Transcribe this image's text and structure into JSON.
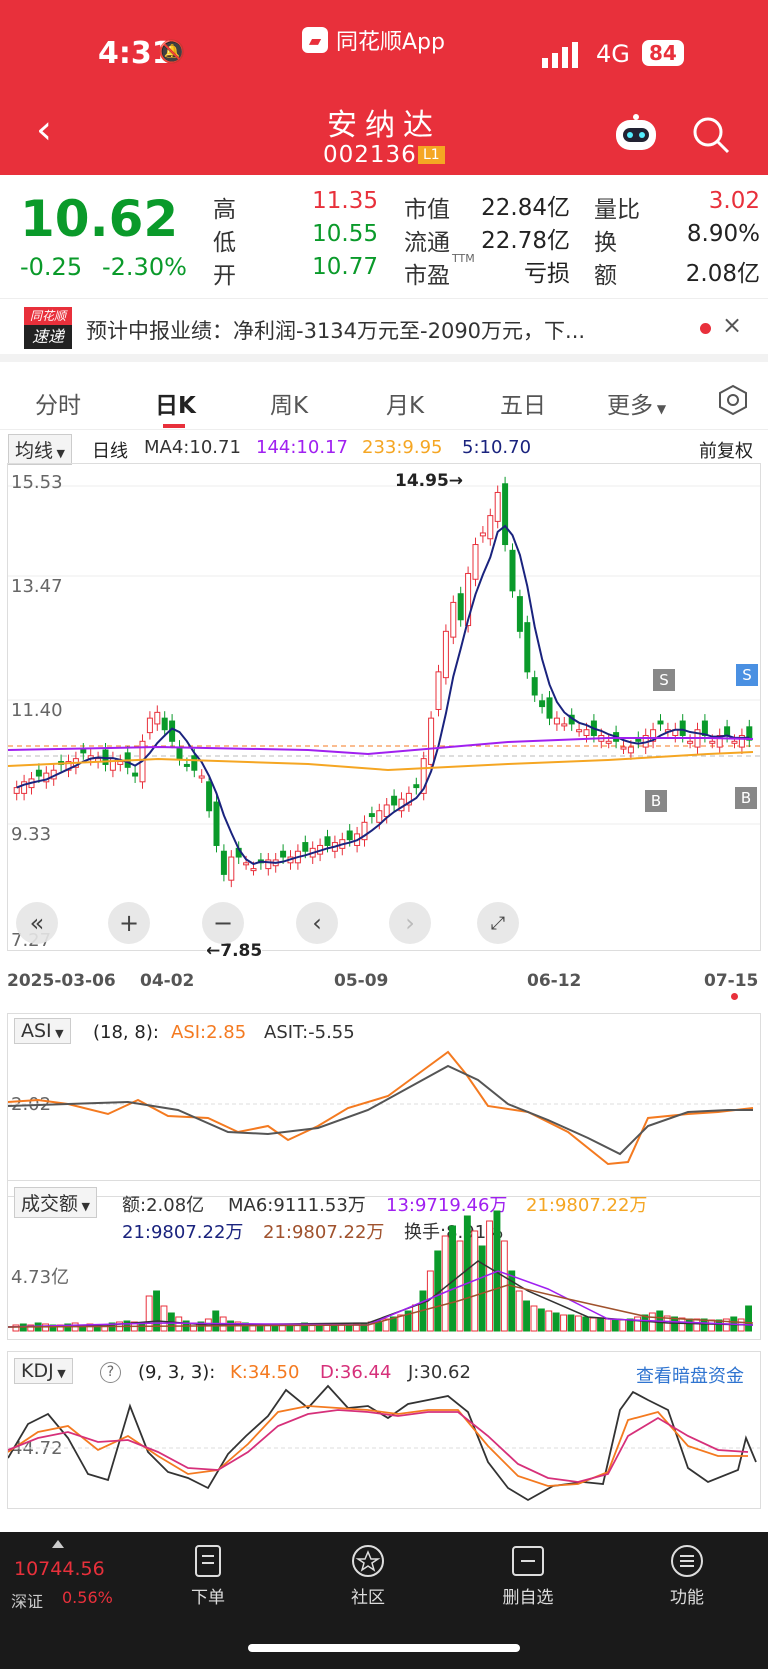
{
  "status": {
    "time": "4:31",
    "app_name": "同花顺App",
    "network": "4G",
    "battery": "84"
  },
  "header": {
    "title": "安纳达",
    "code": "002136",
    "level_badge": "L1"
  },
  "quote": {
    "price": "10.62",
    "change": "-0.25",
    "change_pct": "-2.30%",
    "labels": {
      "high": "高",
      "low": "低",
      "open": "开",
      "mkt_cap": "市值",
      "float_cap": "流通",
      "pe": "市盈",
      "pe_sup": "TTM",
      "vol_ratio": "量比",
      "turnover": "换",
      "amount": "额"
    },
    "high": "11.35",
    "low": "10.55",
    "open": "10.77",
    "mkt_cap": "22.84亿",
    "float_cap": "22.78亿",
    "pe": "亏损",
    "vol_ratio": "3.02",
    "turnover": "8.90%",
    "amount": "2.08亿"
  },
  "news": {
    "badge_top": "同花顺",
    "badge_bottom": "速递",
    "text": "预计中报业绩：净利润-3134万元至-2090万元，下...",
    "close": "×"
  },
  "tabs": [
    "分时",
    "日K",
    "周K",
    "月K",
    "五日",
    "更多"
  ],
  "main_chart": {
    "indicator": "均线",
    "period": "日线",
    "ma_labels": [
      {
        "text": "MA4:10.71",
        "color": "#333"
      },
      {
        "text": "144:10.17",
        "color": "#a020f0"
      },
      {
        "text": "233:9.95",
        "color": "#f5a623"
      },
      {
        "text": "5:10.70",
        "color": "#1a237e"
      }
    ],
    "adjust": "前复权",
    "y_ticks": [
      "15.53",
      "13.47",
      "11.40",
      "9.33",
      "7.27"
    ],
    "high_marker": "14.95→",
    "low_marker": "←7.85",
    "x_ticks": [
      "2025-03-06",
      "04-02",
      "05-09",
      "06-12",
      "07-15"
    ],
    "marker_s": "S",
    "marker_b": "B"
  },
  "asi_panel": {
    "indicator": "ASI",
    "params": "(18, 8):",
    "asi": "ASI:2.85",
    "asit": "ASIT:-5.55",
    "tick": "2.02"
  },
  "vol_panel": {
    "indicator": "成交额",
    "line1": [
      "额:2.08亿",
      "MA6:9111.53万",
      "13:9719.46万",
      "21:9807.22万"
    ],
    "line2": [
      "21:9807.22万",
      "21:9807.22万",
      "换手:8.91%"
    ],
    "tick": "4.73亿"
  },
  "kdj_panel": {
    "indicator": "KDJ",
    "help": "?",
    "params": "(9, 3, 3):",
    "k": "K:34.50",
    "d": "D:36.44",
    "j": "J:30.62",
    "link": "查看暗盘资金",
    "tick": "44.72"
  },
  "bottom": {
    "index_value": "10744.56",
    "index_name": "深证",
    "index_pct": "0.56%",
    "nav": [
      "下单",
      "社区",
      "删自选",
      "功能"
    ]
  }
}
